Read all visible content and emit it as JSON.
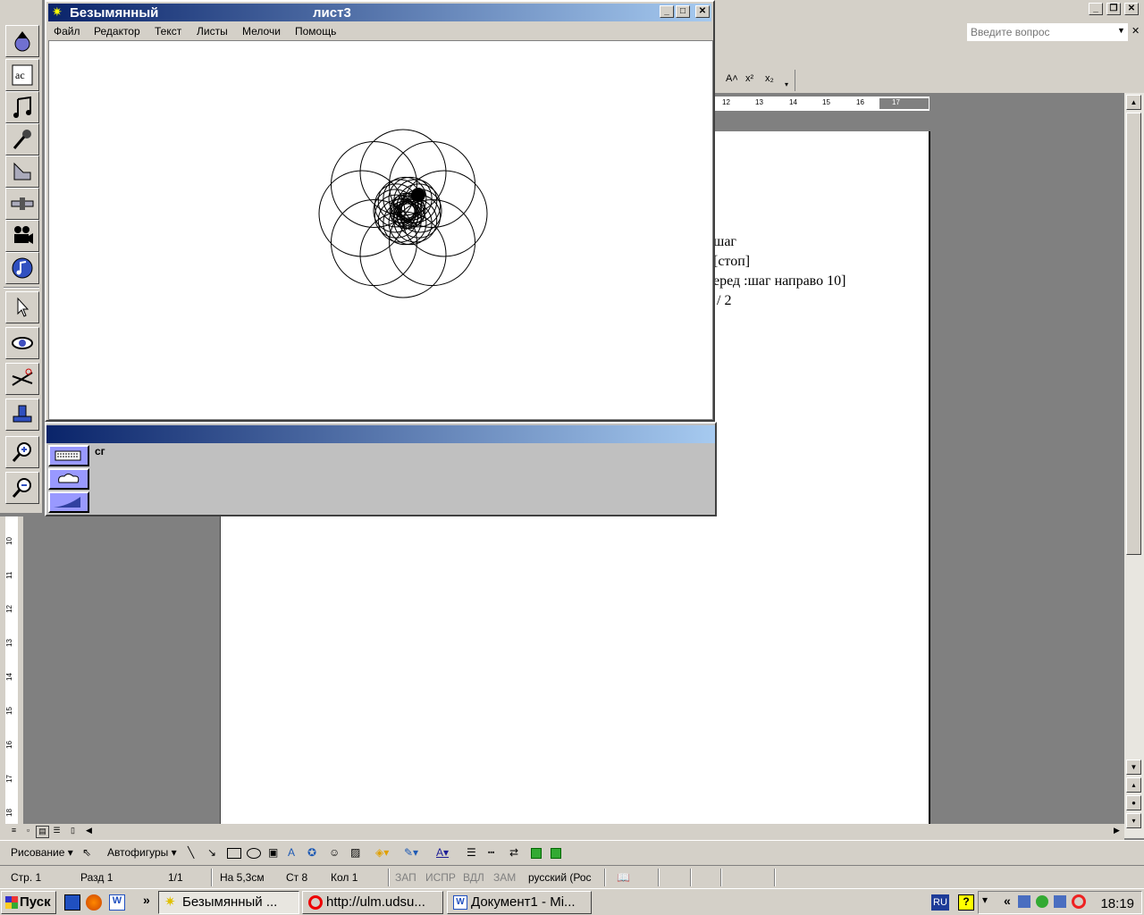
{
  "logo_window": {
    "title": "Безымянный",
    "sheet": "лист3",
    "menu": [
      "Файл",
      "Редактор",
      "Текст",
      "Листы",
      "Мелочи",
      "Помощь"
    ]
  },
  "command_window": {
    "text": "сг"
  },
  "word": {
    "ask_placeholder": "Введите вопрос",
    "doc_lines": [
      "шаг",
      "[стоп]",
      "еред :шаг направо 10]",
      "/ 2"
    ],
    "ruler_ticks": [
      "12",
      "13",
      "14",
      "15",
      "16",
      "17"
    ],
    "left_ruler_ticks": [
      "10",
      "11",
      "12",
      "13",
      "14",
      "15",
      "16",
      "17",
      "18"
    ]
  },
  "drawing_toolbar": {
    "draw_label": "Рисование ▾",
    "autoshapes_label": "Автофигуры ▾"
  },
  "statusbar": {
    "page": "Стр. 1",
    "section": "Разд 1",
    "pages": "1/1",
    "at": "На 5,3см",
    "line": "Ст 8",
    "col": "Кол 1",
    "rec": "ЗАП",
    "trk": "ИСПР",
    "ext": "ВДЛ",
    "ovr": "ЗАМ",
    "language": "русский (Рос"
  },
  "taskbar": {
    "start_label": "Пуск",
    "tasks": [
      {
        "label": "Безымянный ...",
        "active": true
      },
      {
        "label": "http://ulm.udsu...",
        "active": false
      },
      {
        "label": "Документ1 - Mi...",
        "active": false
      }
    ],
    "lang": "RU",
    "clock": "18:19"
  }
}
